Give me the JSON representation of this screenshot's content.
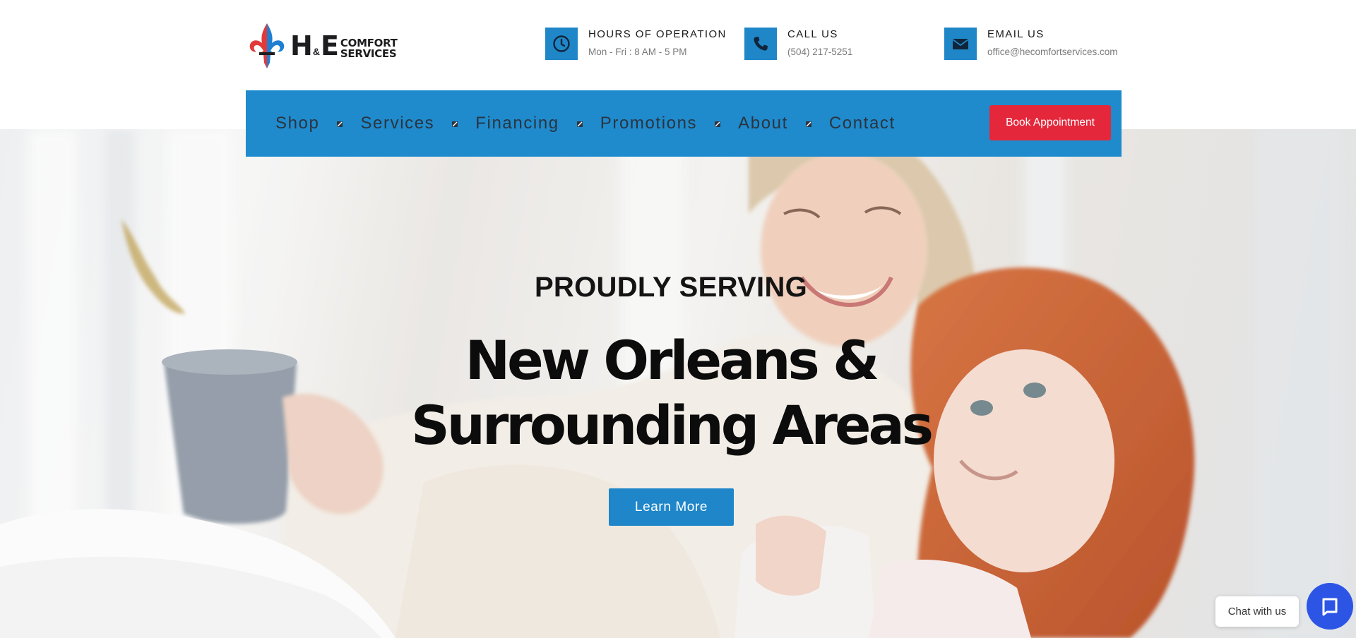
{
  "brand": {
    "logo_main": "H",
    "logo_amp": "&",
    "logo_e": "E",
    "logo_line1": "COMFORT",
    "logo_line2": "SERVICES"
  },
  "header": {
    "hours": {
      "title": "HOURS OF OPERATION",
      "value": "Mon - Fri : 8 AM - 5 PM",
      "icon": "clock-icon"
    },
    "call": {
      "title": "CALL US",
      "value": "(504) 217-5251",
      "icon": "phone-icon"
    },
    "email": {
      "title": "EMAIL US",
      "value": "office@hecomfortservices.com",
      "icon": "envelope-icon"
    }
  },
  "nav": {
    "items": [
      "Shop",
      "Services",
      "Financing",
      "Promotions",
      "About",
      "Contact"
    ],
    "book_label": "Book Appointment"
  },
  "hero": {
    "kicker": "PROUDLY SERVING",
    "headline_line1": "New Orleans &",
    "headline_line2": "Surrounding Areas",
    "cta_label": "Learn More"
  },
  "chat": {
    "label": "Chat with us"
  },
  "colors": {
    "brand_blue": "#1f8bcd",
    "accent_red": "#e5273b",
    "chat_blue": "#2c55e6"
  }
}
